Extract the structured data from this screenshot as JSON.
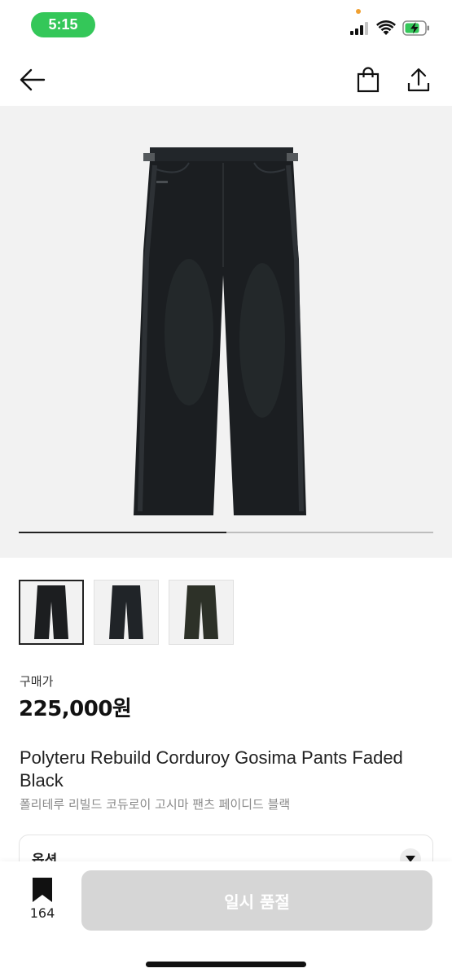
{
  "status_bar": {
    "time": "5:15"
  },
  "nav": {
    "back_icon": "arrow-left-icon",
    "bag_icon": "shopping-bag-icon",
    "share_icon": "share-icon"
  },
  "gallery": {
    "progress": 0.5,
    "thumbnail_count": 3,
    "thumbnail_colors": [
      "#1c1e20",
      "#202428",
      "#2d3128"
    ]
  },
  "price": {
    "label": "구매가",
    "value": "225,000원"
  },
  "product": {
    "name_en": "Polyteru Rebuild Corduroy Gosima Pants Faded Black",
    "name_ko": "폴리테루 리빌드 코듀로이 고시마 팬츠 페이디드 블랙"
  },
  "option": {
    "label": "옵션"
  },
  "bottom_bar": {
    "bookmark_count": "164",
    "soldout_label": "일시 품절"
  },
  "colors": {
    "status_pill": "#34c759",
    "disabled_button": "#d6d6d6",
    "hero_background": "#f2f2f2"
  }
}
